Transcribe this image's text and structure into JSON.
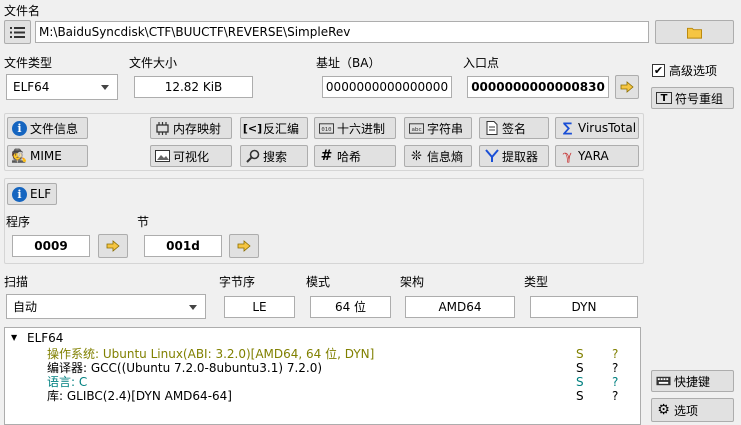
{
  "file": {
    "name_label": "文件名",
    "path": "M:\\BaiduSyncdisk\\CTF\\BUUCTF\\REVERSE\\SimpleRev"
  },
  "summary": {
    "type_label": "文件类型",
    "type_value": "ELF64",
    "size_label": "文件大小",
    "size_value": "12.82 KiB",
    "base_label": "基址（BA）",
    "base_value": "0000000000000000",
    "entry_label": "入口点",
    "entry_value": "0000000000000830"
  },
  "right_panel": {
    "advanced_label": "高级选项",
    "advanced_checked": true,
    "rename_label": "符号重组",
    "shortcut_label": "快捷键",
    "options_label": "选项"
  },
  "tools": {
    "row1": [
      "文件信息",
      "内存映射",
      "反汇编",
      "十六进制",
      "字符串",
      "签名",
      "VirusTotal"
    ],
    "row2": [
      "MIME",
      "可视化",
      "搜索",
      "哈希",
      "信息熵",
      "提取器",
      "YARA"
    ]
  },
  "elf": {
    "button_label": "ELF",
    "program_label": "程序",
    "program_value": "0009",
    "section_label": "节",
    "section_value": "001d"
  },
  "scan": {
    "scan_label": "扫描",
    "scan_value": "自动",
    "endian_label": "字节序",
    "endian_value": "LE",
    "mode_label": "模式",
    "mode_value": "64 位",
    "arch_label": "架构",
    "arch_value": "AMD64",
    "type_label": "类型",
    "type_value": "DYN"
  },
  "results": {
    "root": "ELF64",
    "rows": [
      {
        "text": "操作系统: Ubuntu Linux(ABI: 3.2.0)[AMD64, 64 位, DYN]",
        "s": "S",
        "q": "?",
        "color": "#808000"
      },
      {
        "text": "编译器: GCC((Ubuntu 7.2.0-8ubuntu3.1) 7.2.0)",
        "s": "S",
        "q": "?",
        "color": "#000000"
      },
      {
        "text": "语言: C",
        "s": "S",
        "q": "?",
        "color": "#008080"
      },
      {
        "text": "库: GLIBC(2.4)[DYN AMD64-64]",
        "s": "S",
        "q": "?",
        "color": "#000000"
      }
    ]
  }
}
